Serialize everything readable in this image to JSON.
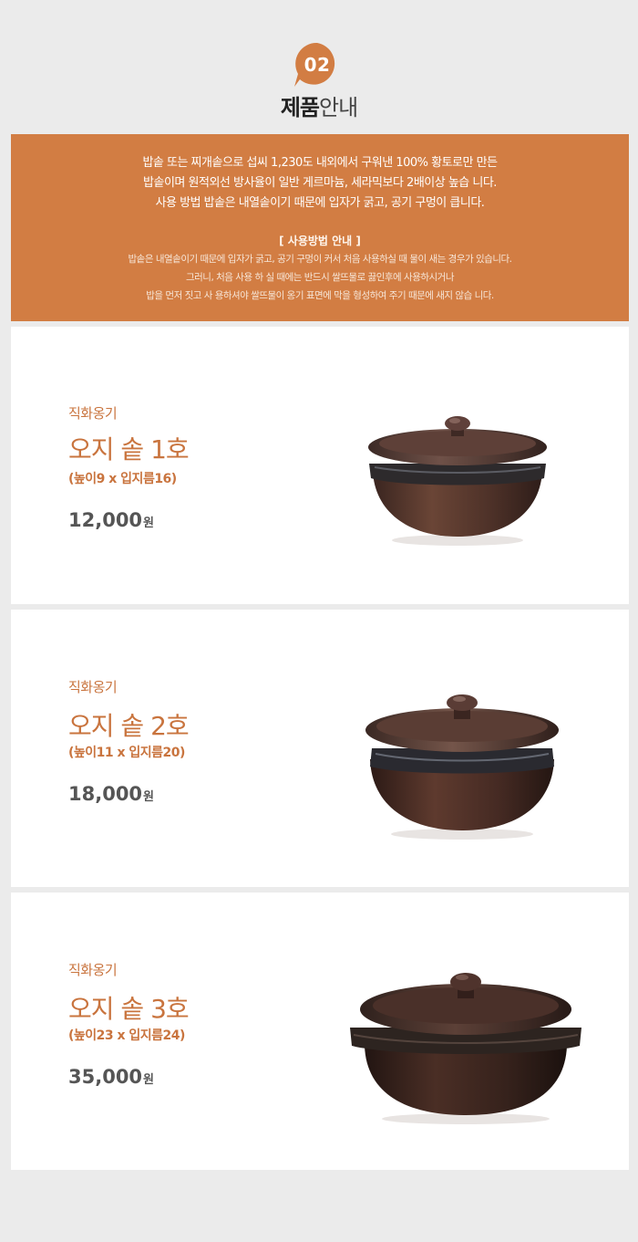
{
  "header": {
    "number": "02",
    "title_bold": "제품",
    "title_rest": "안내"
  },
  "notice": {
    "description": [
      "밥솥 또는 찌개솥으로 섭씨 1,230도 내외에서 구워낸 100% 황토로만 만든",
      "밥솥이며 원적외선 방사율이 일반 게르마늄, 세라믹보다 2배이상 높습 니다.",
      "사용 방법 밥솥은 내열솥이기 때문에 입자가 굵고, 공기 구멍이 큽니다."
    ],
    "usage_title": "[ 사용방법 안내 ]",
    "usage": [
      "밥솥은 내열솥이기 때문에 입자가 굵고, 공기 구멍이 커서 처음 사용하실 때 물이 새는 경우가 있습니다.",
      "그러니, 처음 사용 하 실 때에는 반드시 쌀뜨물로 끓인후에 사용하시거나",
      "밥을 먼저 짓고 사 용하셔야 쌀뜨물이 옹기 표면에 막을 형성하여 주기 때문에 새지 않습 니다."
    ]
  },
  "products": [
    {
      "category": "직화옹기",
      "name": "오지 솥 1호",
      "spec": "(높이9 x 입지름16)",
      "price": "12,000",
      "unit": "원"
    },
    {
      "category": "직화옹기",
      "name": "오지 솥 2호",
      "spec": "(높이11 x 입지름20)",
      "price": "18,000",
      "unit": "원"
    },
    {
      "category": "직화옹기",
      "name": "오지 솥 3호",
      "spec": "(높이23 x 입지름24)",
      "price": "35,000",
      "unit": "원"
    }
  ],
  "colors": {
    "accent": "#d27d43",
    "accent_text": "#c9743e",
    "page_bg": "#ebebeb",
    "pot_body": "#4a2d24",
    "pot_rim": "#2f2624"
  }
}
